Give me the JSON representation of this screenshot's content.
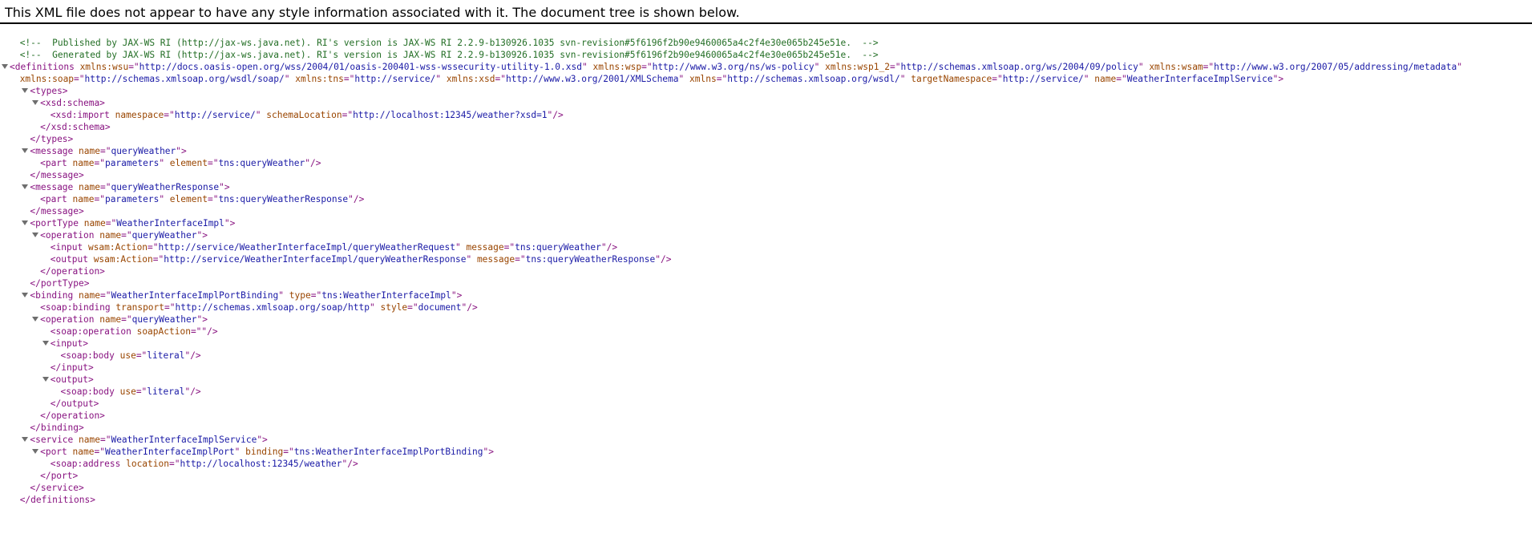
{
  "notice": "This XML file does not appear to have any style information associated with it. The document tree is shown below.",
  "lines": [
    {
      "indent": 1,
      "tog": false,
      "parts": [
        [
          "comment",
          "<!--  Published by JAX-WS RI (http://jax-ws.java.net). RI's version is JAX-WS RI 2.2.9-b130926.1035 svn-revision#5f6196f2b90e9460065a4c2f4e30e065b245e51e.  -->"
        ]
      ]
    },
    {
      "indent": 1,
      "tog": false,
      "parts": [
        [
          "comment",
          "<!--  Generated by JAX-WS RI (http://jax-ws.java.net). RI's version is JAX-WS RI 2.2.9-b130926.1035 svn-revision#5f6196f2b90e9460065a4c2f4e30e065b245e51e.  -->"
        ]
      ]
    },
    {
      "indent": 0,
      "tog": true,
      "parts": [
        [
          "tag",
          "<definitions"
        ],
        [
          "attr",
          " xmlns:wsu"
        ],
        [
          "tag",
          "=\""
        ],
        [
          "val",
          "http://docs.oasis-open.org/wss/2004/01/oasis-200401-wss-wssecurity-utility-1.0.xsd"
        ],
        [
          "tag",
          "\""
        ],
        [
          "attr",
          " xmlns:wsp"
        ],
        [
          "tag",
          "=\""
        ],
        [
          "val",
          "http://www.w3.org/ns/ws-policy"
        ],
        [
          "tag",
          "\""
        ],
        [
          "attr",
          " xmlns:wsp1_2"
        ],
        [
          "tag",
          "=\""
        ],
        [
          "val",
          "http://schemas.xmlsoap.org/ws/2004/09/policy"
        ],
        [
          "tag",
          "\""
        ],
        [
          "attr",
          " xmlns:wsam"
        ],
        [
          "tag",
          "=\""
        ],
        [
          "val",
          "http://www.w3.org/2007/05/addressing/metadata"
        ],
        [
          "tag",
          "\""
        ]
      ]
    },
    {
      "indent": 1,
      "tog": false,
      "parts": [
        [
          "attr",
          "xmlns:soap"
        ],
        [
          "tag",
          "=\""
        ],
        [
          "val",
          "http://schemas.xmlsoap.org/wsdl/soap/"
        ],
        [
          "tag",
          "\""
        ],
        [
          "attr",
          " xmlns:tns"
        ],
        [
          "tag",
          "=\""
        ],
        [
          "val",
          "http://service/"
        ],
        [
          "tag",
          "\""
        ],
        [
          "attr",
          " xmlns:xsd"
        ],
        [
          "tag",
          "=\""
        ],
        [
          "val",
          "http://www.w3.org/2001/XMLSchema"
        ],
        [
          "tag",
          "\""
        ],
        [
          "attr",
          " xmlns"
        ],
        [
          "tag",
          "=\""
        ],
        [
          "val",
          "http://schemas.xmlsoap.org/wsdl/"
        ],
        [
          "tag",
          "\""
        ],
        [
          "attr",
          " targetNamespace"
        ],
        [
          "tag",
          "=\""
        ],
        [
          "val",
          "http://service/"
        ],
        [
          "tag",
          "\""
        ],
        [
          "attr",
          " name"
        ],
        [
          "tag",
          "=\""
        ],
        [
          "val",
          "WeatherInterfaceImplService"
        ],
        [
          "tag",
          "\">"
        ]
      ]
    },
    {
      "indent": 2,
      "tog": true,
      "parts": [
        [
          "tag",
          "<types>"
        ]
      ]
    },
    {
      "indent": 3,
      "tog": true,
      "parts": [
        [
          "tag",
          "<xsd:schema>"
        ]
      ]
    },
    {
      "indent": 4,
      "tog": false,
      "parts": [
        [
          "tag",
          "<xsd:import"
        ],
        [
          "attr",
          " namespace"
        ],
        [
          "tag",
          "=\""
        ],
        [
          "val",
          "http://service/"
        ],
        [
          "tag",
          "\""
        ],
        [
          "attr",
          " schemaLocation"
        ],
        [
          "tag",
          "=\""
        ],
        [
          "val",
          "http://localhost:12345/weather?xsd=1"
        ],
        [
          "tag",
          "\"/>"
        ]
      ]
    },
    {
      "indent": 3,
      "tog": false,
      "parts": [
        [
          "tag",
          "</xsd:schema>"
        ]
      ]
    },
    {
      "indent": 2,
      "tog": false,
      "parts": [
        [
          "tag",
          "</types>"
        ]
      ]
    },
    {
      "indent": 2,
      "tog": true,
      "parts": [
        [
          "tag",
          "<message"
        ],
        [
          "attr",
          " name"
        ],
        [
          "tag",
          "=\""
        ],
        [
          "val",
          "queryWeather"
        ],
        [
          "tag",
          "\">"
        ]
      ]
    },
    {
      "indent": 3,
      "tog": false,
      "parts": [
        [
          "tag",
          "<part"
        ],
        [
          "attr",
          " name"
        ],
        [
          "tag",
          "=\""
        ],
        [
          "val",
          "parameters"
        ],
        [
          "tag",
          "\""
        ],
        [
          "attr",
          " element"
        ],
        [
          "tag",
          "=\""
        ],
        [
          "val",
          "tns:queryWeather"
        ],
        [
          "tag",
          "\"/>"
        ]
      ]
    },
    {
      "indent": 2,
      "tog": false,
      "parts": [
        [
          "tag",
          "</message>"
        ]
      ]
    },
    {
      "indent": 2,
      "tog": true,
      "parts": [
        [
          "tag",
          "<message"
        ],
        [
          "attr",
          " name"
        ],
        [
          "tag",
          "=\""
        ],
        [
          "val",
          "queryWeatherResponse"
        ],
        [
          "tag",
          "\">"
        ]
      ]
    },
    {
      "indent": 3,
      "tog": false,
      "parts": [
        [
          "tag",
          "<part"
        ],
        [
          "attr",
          " name"
        ],
        [
          "tag",
          "=\""
        ],
        [
          "val",
          "parameters"
        ],
        [
          "tag",
          "\""
        ],
        [
          "attr",
          " element"
        ],
        [
          "tag",
          "=\""
        ],
        [
          "val",
          "tns:queryWeatherResponse"
        ],
        [
          "tag",
          "\"/>"
        ]
      ]
    },
    {
      "indent": 2,
      "tog": false,
      "parts": [
        [
          "tag",
          "</message>"
        ]
      ]
    },
    {
      "indent": 2,
      "tog": true,
      "parts": [
        [
          "tag",
          "<portType"
        ],
        [
          "attr",
          " name"
        ],
        [
          "tag",
          "=\""
        ],
        [
          "val",
          "WeatherInterfaceImpl"
        ],
        [
          "tag",
          "\">"
        ]
      ]
    },
    {
      "indent": 3,
      "tog": true,
      "parts": [
        [
          "tag",
          "<operation"
        ],
        [
          "attr",
          " name"
        ],
        [
          "tag",
          "=\""
        ],
        [
          "val",
          "queryWeather"
        ],
        [
          "tag",
          "\">"
        ]
      ]
    },
    {
      "indent": 4,
      "tog": false,
      "parts": [
        [
          "tag",
          "<input"
        ],
        [
          "attr",
          " wsam:Action"
        ],
        [
          "tag",
          "=\""
        ],
        [
          "val",
          "http://service/WeatherInterfaceImpl/queryWeatherRequest"
        ],
        [
          "tag",
          "\""
        ],
        [
          "attr",
          " message"
        ],
        [
          "tag",
          "=\""
        ],
        [
          "val",
          "tns:queryWeather"
        ],
        [
          "tag",
          "\"/>"
        ]
      ]
    },
    {
      "indent": 4,
      "tog": false,
      "parts": [
        [
          "tag",
          "<output"
        ],
        [
          "attr",
          " wsam:Action"
        ],
        [
          "tag",
          "=\""
        ],
        [
          "val",
          "http://service/WeatherInterfaceImpl/queryWeatherResponse"
        ],
        [
          "tag",
          "\""
        ],
        [
          "attr",
          " message"
        ],
        [
          "tag",
          "=\""
        ],
        [
          "val",
          "tns:queryWeatherResponse"
        ],
        [
          "tag",
          "\"/>"
        ]
      ]
    },
    {
      "indent": 3,
      "tog": false,
      "parts": [
        [
          "tag",
          "</operation>"
        ]
      ]
    },
    {
      "indent": 2,
      "tog": false,
      "parts": [
        [
          "tag",
          "</portType>"
        ]
      ]
    },
    {
      "indent": 2,
      "tog": true,
      "parts": [
        [
          "tag",
          "<binding"
        ],
        [
          "attr",
          " name"
        ],
        [
          "tag",
          "=\""
        ],
        [
          "val",
          "WeatherInterfaceImplPortBinding"
        ],
        [
          "tag",
          "\""
        ],
        [
          "attr",
          " type"
        ],
        [
          "tag",
          "=\""
        ],
        [
          "val",
          "tns:WeatherInterfaceImpl"
        ],
        [
          "tag",
          "\">"
        ]
      ]
    },
    {
      "indent": 3,
      "tog": false,
      "parts": [
        [
          "tag",
          "<soap:binding"
        ],
        [
          "attr",
          " transport"
        ],
        [
          "tag",
          "=\""
        ],
        [
          "val",
          "http://schemas.xmlsoap.org/soap/http"
        ],
        [
          "tag",
          "\""
        ],
        [
          "attr",
          " style"
        ],
        [
          "tag",
          "=\""
        ],
        [
          "val",
          "document"
        ],
        [
          "tag",
          "\"/>"
        ]
      ]
    },
    {
      "indent": 3,
      "tog": true,
      "parts": [
        [
          "tag",
          "<operation"
        ],
        [
          "attr",
          " name"
        ],
        [
          "tag",
          "=\""
        ],
        [
          "val",
          "queryWeather"
        ],
        [
          "tag",
          "\">"
        ]
      ]
    },
    {
      "indent": 4,
      "tog": false,
      "parts": [
        [
          "tag",
          "<soap:operation"
        ],
        [
          "attr",
          " soapAction"
        ],
        [
          "tag",
          "=\"\"/>"
        ]
      ]
    },
    {
      "indent": 4,
      "tog": true,
      "parts": [
        [
          "tag",
          "<input>"
        ]
      ]
    },
    {
      "indent": 5,
      "tog": false,
      "parts": [
        [
          "tag",
          "<soap:body"
        ],
        [
          "attr",
          " use"
        ],
        [
          "tag",
          "=\""
        ],
        [
          "val",
          "literal"
        ],
        [
          "tag",
          "\"/>"
        ]
      ]
    },
    {
      "indent": 4,
      "tog": false,
      "parts": [
        [
          "tag",
          "</input>"
        ]
      ]
    },
    {
      "indent": 4,
      "tog": true,
      "parts": [
        [
          "tag",
          "<output>"
        ]
      ]
    },
    {
      "indent": 5,
      "tog": false,
      "parts": [
        [
          "tag",
          "<soap:body"
        ],
        [
          "attr",
          " use"
        ],
        [
          "tag",
          "=\""
        ],
        [
          "val",
          "literal"
        ],
        [
          "tag",
          "\"/>"
        ]
      ]
    },
    {
      "indent": 4,
      "tog": false,
      "parts": [
        [
          "tag",
          "</output>"
        ]
      ]
    },
    {
      "indent": 3,
      "tog": false,
      "parts": [
        [
          "tag",
          "</operation>"
        ]
      ]
    },
    {
      "indent": 2,
      "tog": false,
      "parts": [
        [
          "tag",
          "</binding>"
        ]
      ]
    },
    {
      "indent": 2,
      "tog": true,
      "parts": [
        [
          "tag",
          "<service"
        ],
        [
          "attr",
          " name"
        ],
        [
          "tag",
          "=\""
        ],
        [
          "val",
          "WeatherInterfaceImplService"
        ],
        [
          "tag",
          "\">"
        ]
      ]
    },
    {
      "indent": 3,
      "tog": true,
      "parts": [
        [
          "tag",
          "<port"
        ],
        [
          "attr",
          " name"
        ],
        [
          "tag",
          "=\""
        ],
        [
          "val",
          "WeatherInterfaceImplPort"
        ],
        [
          "tag",
          "\""
        ],
        [
          "attr",
          " binding"
        ],
        [
          "tag",
          "=\""
        ],
        [
          "val",
          "tns:WeatherInterfaceImplPortBinding"
        ],
        [
          "tag",
          "\">"
        ]
      ]
    },
    {
      "indent": 4,
      "tog": false,
      "parts": [
        [
          "tag",
          "<soap:address"
        ],
        [
          "attr",
          " location"
        ],
        [
          "tag",
          "=\""
        ],
        [
          "val",
          "http://localhost:12345/weather"
        ],
        [
          "tag",
          "\"/>"
        ]
      ]
    },
    {
      "indent": 3,
      "tog": false,
      "parts": [
        [
          "tag",
          "</port>"
        ]
      ]
    },
    {
      "indent": 2,
      "tog": false,
      "parts": [
        [
          "tag",
          "</service>"
        ]
      ]
    },
    {
      "indent": 1,
      "tog": false,
      "parts": [
        [
          "tag",
          "</definitions>"
        ]
      ]
    }
  ]
}
